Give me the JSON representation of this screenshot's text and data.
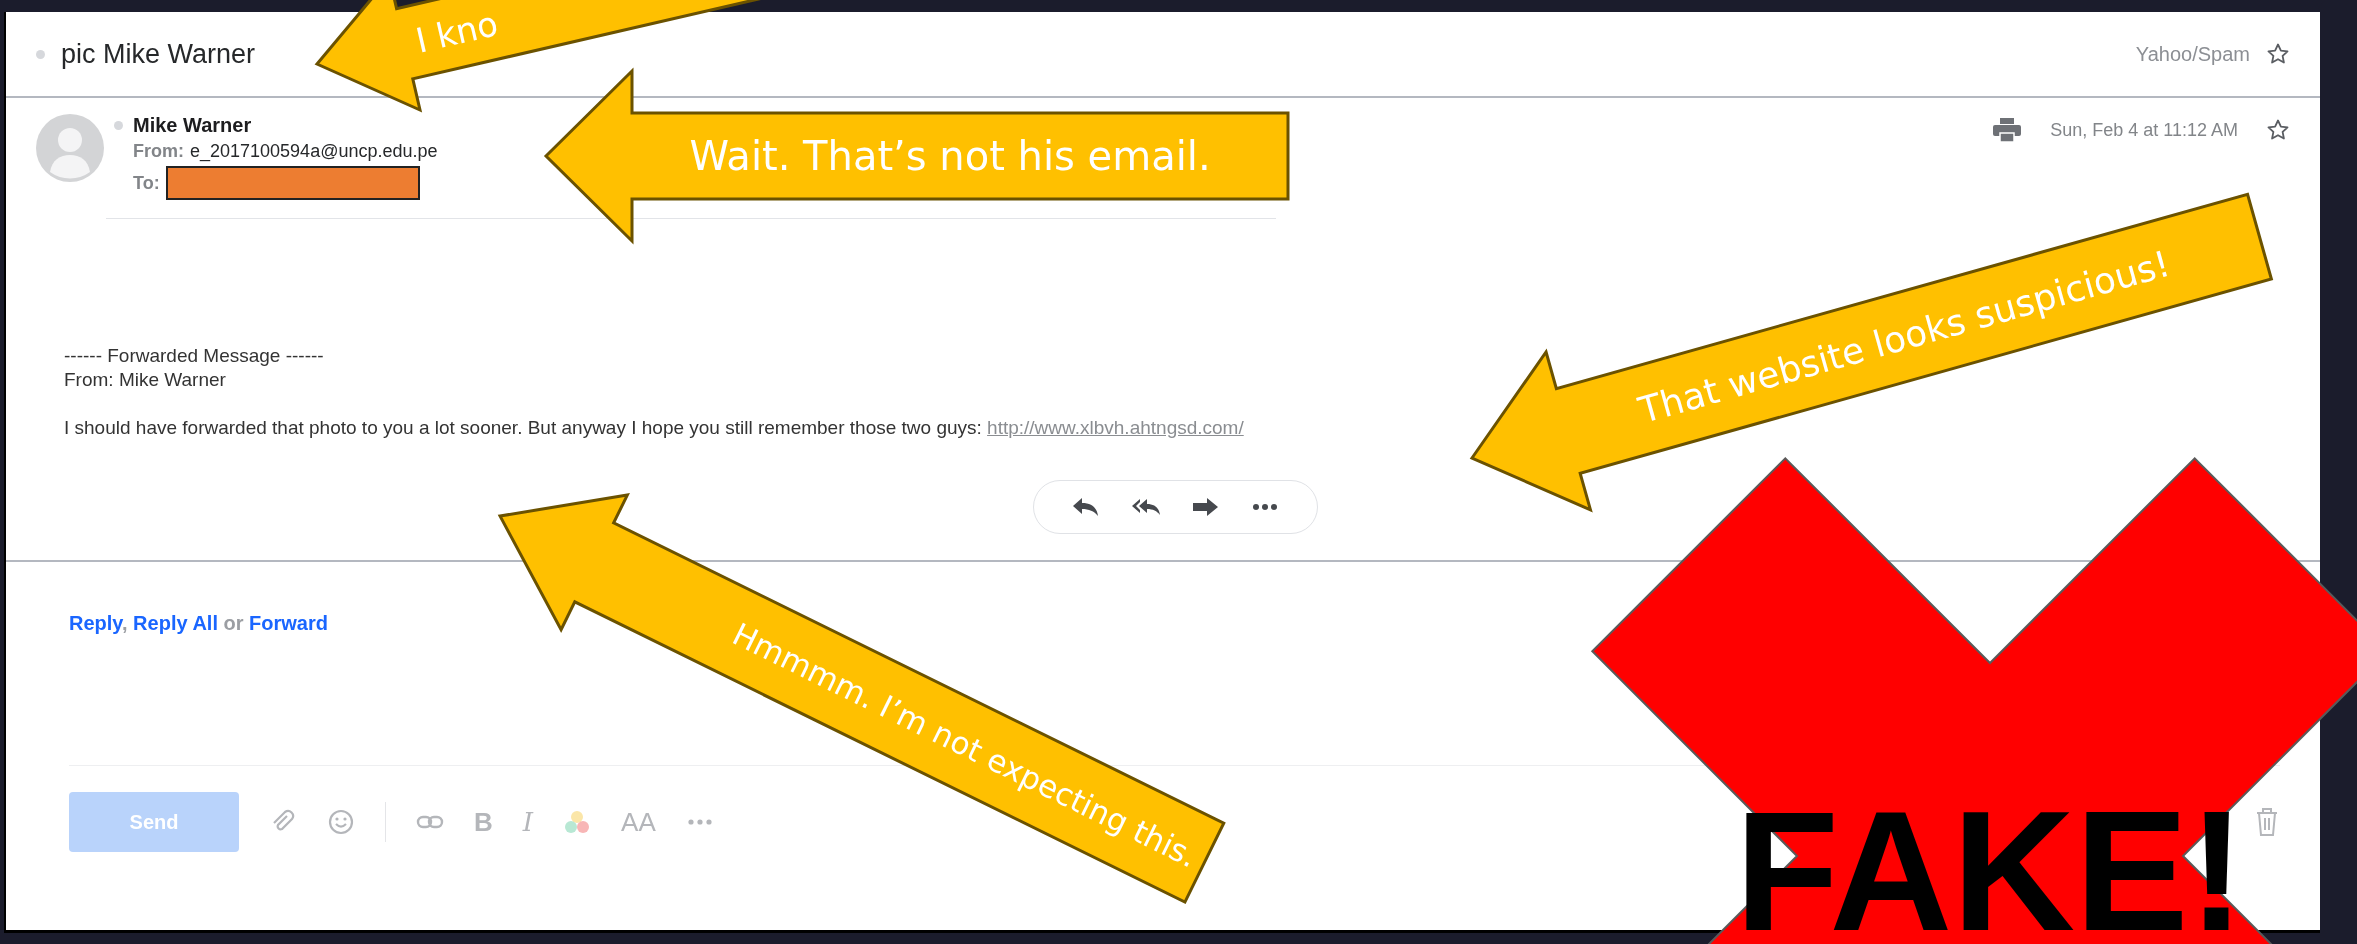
{
  "message": {
    "subject": "pic Mike Warner",
    "folder": "Yahoo/Spam",
    "sender_name": "Mike Warner",
    "from_label": "From:",
    "from_address": "e_2017100594a@uncp.edu.pe",
    "to_label": "To:",
    "date": "Sun, Feb 4 at 11:12 AM",
    "body": [
      "------ Forwarded Message ------",
      "From: Mike Warner"
    ],
    "text": "I should have forwarded that photo to you a lot sooner. But anyway I hope you still remember those two guys: ",
    "link": "http://www.xlbvh.ahtngsd.com/"
  },
  "reply_links": {
    "reply": "Reply",
    "separator": ", ",
    "reply_all": "Reply All",
    "or": " or ",
    "forward": "Forward"
  },
  "compose": {
    "send": "Send",
    "send_disabled": true,
    "bold": "B",
    "italic": "I",
    "font_size": "AA"
  },
  "callouts": [
    {
      "text": "I kno"
    },
    {
      "text": "Wait. That’s not his email."
    },
    {
      "text": "That website looks suspicious!"
    },
    {
      "text": "Hmmmm. I’m not expecting this."
    }
  ],
  "stamp": "FAKE!"
}
